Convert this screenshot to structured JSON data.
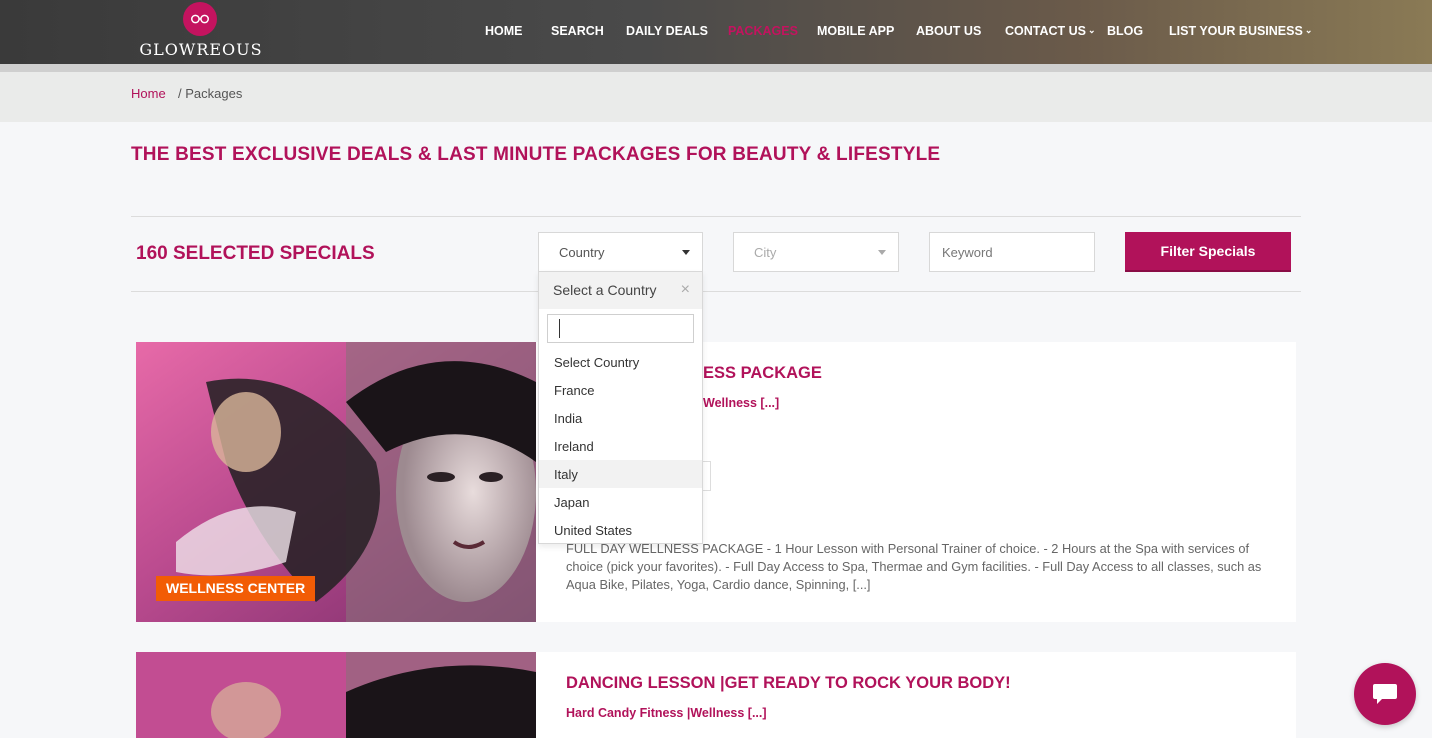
{
  "brand": {
    "name": "GLOWREOUS",
    "color": "#c4135f"
  },
  "nav": {
    "items": [
      {
        "label": "HOME"
      },
      {
        "label": "SEARCH"
      },
      {
        "label": "DAILY DEALS"
      },
      {
        "label": "PACKAGES",
        "active": true
      },
      {
        "label": "MOBILE APP"
      },
      {
        "label": "ABOUT US"
      },
      {
        "label": "CONTACT US",
        "has_dropdown": true
      },
      {
        "label": "BLOG"
      },
      {
        "label": "LIST YOUR BUSINESS",
        "has_dropdown": true
      }
    ]
  },
  "breadcrumb": {
    "home": "Home",
    "current": "/ Packages"
  },
  "page": {
    "title": "THE BEST EXCLUSIVE DEALS & LAST MINUTE PACKAGES FOR BEAUTY & LIFESTYLE"
  },
  "filters": {
    "count_title": "160 SELECTED SPECIALS",
    "country_label": "Country",
    "city_label": "City",
    "keyword_placeholder": "Keyword",
    "button_label": "Filter Specials"
  },
  "country_dropdown": {
    "header": "Select a Country",
    "close": "×",
    "search_value": "",
    "options": [
      "Select Country",
      "France",
      "India",
      "Ireland",
      "Italy",
      "Japan",
      "United States"
    ],
    "highlighted": "Italy"
  },
  "cards": [
    {
      "title_visible": "ESS PACKAGE",
      "subtitle_visible": "Wellness [...]",
      "description": "FULL DAY WELLNESS PACKAGE - 1 Hour Lesson with Personal Trainer of choice. - 2 Hours at the Spa with services of choice (pick your favorites). - Full Day Access to Spa, Thermae and Gym facilities. - Full Day Access to all classes, such as Aqua Bike, Pilates, Yoga, Cardio dance, Spinning, [...]",
      "badge": "WELLNESS CENTER",
      "badge_color": "#f25c05"
    },
    {
      "title": "DANCING LESSON |GET READY TO ROCK YOUR BODY!",
      "subtitle": "Hard Candy Fitness |Wellness [...]"
    }
  ],
  "icons": {
    "logo": "glasses-icon",
    "chat": "chat-bubble-icon"
  },
  "colors": {
    "accent": "#b1125a",
    "badge": "#f25c05"
  }
}
